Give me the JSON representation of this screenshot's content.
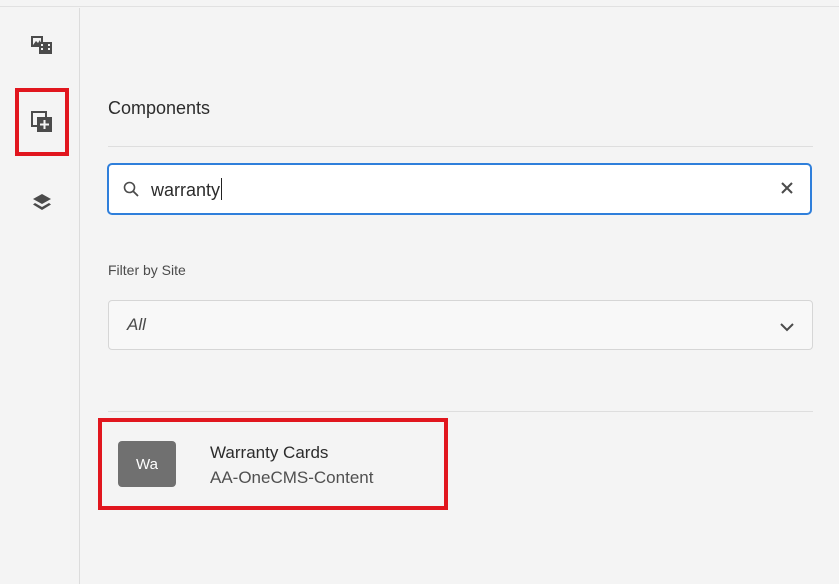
{
  "rail": {
    "items": [
      {
        "name": "assets"
      },
      {
        "name": "components"
      },
      {
        "name": "content-tree"
      }
    ]
  },
  "panel": {
    "title": "Components",
    "search": {
      "value": "warranty"
    },
    "filter": {
      "label": "Filter by Site",
      "selected": "All"
    },
    "results": [
      {
        "badge": "Wa",
        "title": "Warranty Cards",
        "group": "AA-OneCMS-Content"
      }
    ]
  },
  "colors": {
    "highlight": "#e1161e",
    "focus": "#2f7fdb",
    "badge": "#707070"
  }
}
